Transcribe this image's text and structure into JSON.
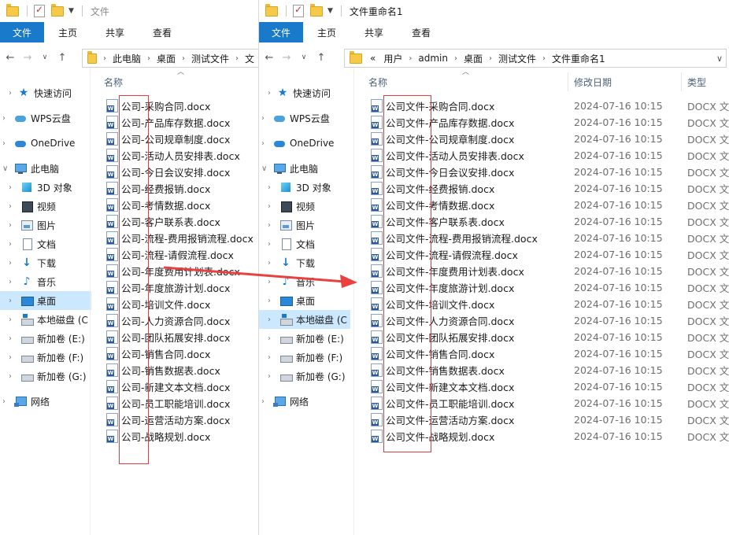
{
  "left": {
    "title": "文件",
    "ribbon_tabs": [
      "文件",
      "主页",
      "共享",
      "查看"
    ],
    "breadcrumb": [
      "此电脑",
      "桌面",
      "测试文件",
      "文"
    ],
    "column_name": "名称",
    "nav": [
      {
        "label": "快速访问",
        "icon": "star-icon"
      },
      {
        "label": "WPS云盘",
        "icon": "cloud-icon"
      },
      {
        "label": "OneDrive",
        "icon": "onedrive-icon"
      },
      {
        "label": "此电脑",
        "icon": "computer-icon"
      },
      {
        "label": "3D 对象",
        "icon": "cube-icon"
      },
      {
        "label": "视频",
        "icon": "video-icon"
      },
      {
        "label": "图片",
        "icon": "picture-icon"
      },
      {
        "label": "文档",
        "icon": "document-icon"
      },
      {
        "label": "下载",
        "icon": "download-icon"
      },
      {
        "label": "音乐",
        "icon": "music-icon"
      },
      {
        "label": "桌面",
        "icon": "desktop-icon"
      },
      {
        "label": "本地磁盘 (C",
        "icon": "disk-icon"
      },
      {
        "label": "新加卷 (E:)",
        "icon": "drive-icon"
      },
      {
        "label": "新加卷 (F:)",
        "icon": "drive-icon"
      },
      {
        "label": "新加卷 (G:)",
        "icon": "drive-icon"
      },
      {
        "label": "网络",
        "icon": "network-icon"
      }
    ],
    "files": [
      "公司-采购合同.docx",
      "公司-产品库存数据.docx",
      "公司-公司规章制度.docx",
      "公司-活动人员安排表.docx",
      "公司-今日会议安排.docx",
      "公司-经费报销.docx",
      "公司-考情数据.docx",
      "公司-客户联系表.docx",
      "公司-流程-费用报销流程.docx",
      "公司-流程-请假流程.docx",
      "公司-年度费用计划表.docx",
      "公司-年度旅游计划.docx",
      "公司-培训文件.docx",
      "公司-人力资源合同.docx",
      "公司-团队拓展安排.docx",
      "公司-销售合同.docx",
      "公司-销售数据表.docx",
      "公司-新建文本文档.docx",
      "公司-员工职能培训.docx",
      "公司-运营活动方案.docx",
      "公司-战略规划.docx"
    ]
  },
  "right": {
    "title": "文件重命名1",
    "ribbon_tabs": [
      "文件",
      "主页",
      "共享",
      "查看"
    ],
    "breadcrumb_prefix": "«",
    "breadcrumb": [
      "用户",
      "admin",
      "桌面",
      "测试文件",
      "文件重命名1"
    ],
    "columns": {
      "name": "名称",
      "date": "修改日期",
      "type": "类型"
    },
    "nav": [
      {
        "label": "快速访问",
        "icon": "star-icon"
      },
      {
        "label": "WPS云盘",
        "icon": "cloud-icon"
      },
      {
        "label": "OneDrive",
        "icon": "onedrive-icon"
      },
      {
        "label": "此电脑",
        "icon": "computer-icon"
      },
      {
        "label": "3D 对象",
        "icon": "cube-icon"
      },
      {
        "label": "视频",
        "icon": "video-icon"
      },
      {
        "label": "图片",
        "icon": "picture-icon"
      },
      {
        "label": "文档",
        "icon": "document-icon"
      },
      {
        "label": "下载",
        "icon": "download-icon"
      },
      {
        "label": "音乐",
        "icon": "music-icon"
      },
      {
        "label": "桌面",
        "icon": "desktop-icon"
      },
      {
        "label": "本地磁盘 (C",
        "icon": "disk-icon"
      },
      {
        "label": "新加卷 (E:)",
        "icon": "drive-icon"
      },
      {
        "label": "新加卷 (F:)",
        "icon": "drive-icon"
      },
      {
        "label": "新加卷 (G:)",
        "icon": "drive-icon"
      },
      {
        "label": "网络",
        "icon": "network-icon"
      }
    ],
    "files": [
      {
        "name": "公司文件-采购合同.docx",
        "date": "2024-07-16 10:15",
        "type": "DOCX 文档"
      },
      {
        "name": "公司文件-产品库存数据.docx",
        "date": "2024-07-16 10:15",
        "type": "DOCX 文档"
      },
      {
        "name": "公司文件-公司规章制度.docx",
        "date": "2024-07-16 10:15",
        "type": "DOCX 文档"
      },
      {
        "name": "公司文件-活动人员安排表.docx",
        "date": "2024-07-16 10:15",
        "type": "DOCX 文档"
      },
      {
        "name": "公司文件-今日会议安排.docx",
        "date": "2024-07-16 10:15",
        "type": "DOCX 文档"
      },
      {
        "name": "公司文件-经费报销.docx",
        "date": "2024-07-16 10:15",
        "type": "DOCX 文档"
      },
      {
        "name": "公司文件-考情数据.docx",
        "date": "2024-07-16 10:15",
        "type": "DOCX 文档"
      },
      {
        "name": "公司文件-客户联系表.docx",
        "date": "2024-07-16 10:15",
        "type": "DOCX 文档"
      },
      {
        "name": "公司文件-流程-费用报销流程.docx",
        "date": "2024-07-16 10:15",
        "type": "DOCX 文档"
      },
      {
        "name": "公司文件-流程-请假流程.docx",
        "date": "2024-07-16 10:15",
        "type": "DOCX 文档"
      },
      {
        "name": "公司文件-年度费用计划表.docx",
        "date": "2024-07-16 10:15",
        "type": "DOCX 文档"
      },
      {
        "name": "公司文件-年度旅游计划.docx",
        "date": "2024-07-16 10:15",
        "type": "DOCX 文档"
      },
      {
        "name": "公司文件-培训文件.docx",
        "date": "2024-07-16 10:15",
        "type": "DOCX 文档"
      },
      {
        "name": "公司文件-人力资源合同.docx",
        "date": "2024-07-16 10:15",
        "type": "DOCX 文档"
      },
      {
        "name": "公司文件-团队拓展安排.docx",
        "date": "2024-07-16 10:15",
        "type": "DOCX 文档"
      },
      {
        "name": "公司文件-销售合同.docx",
        "date": "2024-07-16 10:15",
        "type": "DOCX 文档"
      },
      {
        "name": "公司文件-销售数据表.docx",
        "date": "2024-07-16 10:15",
        "type": "DOCX 文档"
      },
      {
        "name": "公司文件-新建文本文档.docx",
        "date": "2024-07-16 10:15",
        "type": "DOCX 文档"
      },
      {
        "name": "公司文件-员工职能培训.docx",
        "date": "2024-07-16 10:15",
        "type": "DOCX 文档"
      },
      {
        "name": "公司文件-运营活动方案.docx",
        "date": "2024-07-16 10:15",
        "type": "DOCX 文档"
      },
      {
        "name": "公司文件-战略规划.docx",
        "date": "2024-07-16 10:15",
        "type": "DOCX 文档"
      }
    ]
  },
  "colors": {
    "accent": "#1979ca",
    "selected": "#cce8ff",
    "highlight": "#e23b3b",
    "arrow": "#e8413f"
  }
}
